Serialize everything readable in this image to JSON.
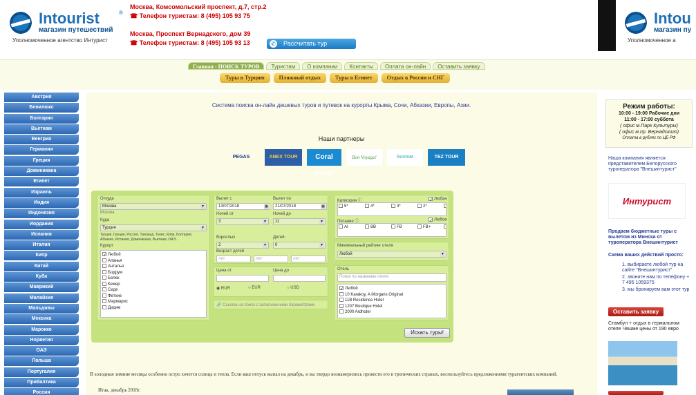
{
  "header": {
    "brand": "Intourist",
    "brand_mark": "®",
    "brand_sub": "магазин путешествий",
    "tagline": "Уполномоченное агентство Интурист",
    "address1": "Москва, Комсомольский проспект, д.7, стр.2",
    "phone1": "☎ Телефон туристам: 8 (495) 105 93 75",
    "address2": "Москва, Проспект Вернадского, дом 39",
    "phone2": "☎ Телефон туристам: 8 (495) 105 93 13",
    "calc_button": "Рассчитать тур",
    "calc_icon": "phone-icon",
    "brand_repeat": "Intou",
    "brand_sub_repeat": "магазин пу",
    "tagline_repeat": "Уполномоченное а"
  },
  "nav": {
    "tabs": [
      "Главная - ПОИСК ТУРОВ",
      "Туристам",
      "О компании",
      "Контакты",
      "Оплата он-лайн",
      "Оставить заявку"
    ],
    "subtabs": [
      "Туры в Турцию",
      "Пляжный отдых",
      "Туры в Египет",
      "Отдых в России и СНГ"
    ]
  },
  "sidebar": {
    "items": [
      "Австрия",
      "Бенилюкс",
      "Болгария",
      "Вьетнам",
      "Венгрия",
      "Германия",
      "Греция",
      "Доминикана",
      "Египет",
      "Израиль",
      "Индия",
      "Индонезия",
      "Иордания",
      "Испания",
      "Италия",
      "Кипр",
      "Китай",
      "Куба",
      "Маврикий",
      "Малайзия",
      "Мальдивы",
      "Мексика",
      "Марокко",
      "Норвегия",
      "ОАЭ",
      "Польша",
      "Португалия",
      "Прибалтика",
      "Россия"
    ]
  },
  "main": {
    "slogan": "Система поиска он-лайн дешевых туров и путевок на курорты Крыма, Сочи, Абхазии, Европы, Азии.",
    "partners_title": "Наши партнеры",
    "partners": [
      "PEGAS",
      "ANEX TOUR",
      "Coral travel",
      "Bon Voyage!",
      "Sunmar",
      "TEZ TOUR"
    ],
    "paragraph": "В холодные зимние месяцы особенно остро хочется солнца и тепла. Если ваш отпуск выпал на декабрь, и вы твердо вознамерились провести его в тропических странах, воспользуйтесь предложениями турагентских компаний.",
    "signature": "Итак, декабрь 2018г."
  },
  "form": {
    "from_label": "Откуда",
    "from_value": "Москва",
    "from_hint": "Москва",
    "to_label": "Куда",
    "to_value": "Турция",
    "to_hint": "Турция, Греция, Россия, Таиланд, Тунис, Кипр, Болгария, Абхазия, Испания, Доминикана, Вьетнам, ОАЭ...",
    "resorts_label": "Курорт",
    "resorts": [
      "Любой",
      "Аланья",
      "Анталья",
      "Бодрум",
      "Белек",
      "Кемер",
      "Сиде",
      "Фетхие",
      "Мармарис",
      "Дидим"
    ],
    "depart_from_label": "Вылет с",
    "depart_from": "13/07/2018",
    "depart_to_label": "Вылет по",
    "depart_to": "21/07/2018",
    "nights_from_label": "Ночей от",
    "nights_from": "3",
    "nights_to_label": "Ночей до",
    "nights_to": "11",
    "adults_label": "Взрослых",
    "adults": "2",
    "children_label": "Детей",
    "children": "0",
    "child_age_label": "Возраст детей",
    "child_ages": [
      "лет",
      "лет",
      "лет"
    ],
    "price_from_label": "Цена от",
    "price_to_label": "Цена до",
    "currencies": [
      "RUR",
      "EUR",
      "USD"
    ],
    "share_hint": "Ссылка на поиск с заполненными параметрами",
    "category_label": "Категория",
    "category_any": "Любая",
    "categories": [
      "5*",
      "4*",
      "3*",
      "2*",
      "1*",
      "HV"
    ],
    "meal_label": "Питание",
    "meal_any": "Любое",
    "meals": [
      "AI",
      "BB",
      "FB",
      "FB+",
      "HB",
      "HB+",
      "RO",
      "UAI"
    ],
    "rating_label": "Минимальный рейтинг отеля",
    "rating_value": "Любой",
    "hotel_label": "Отель",
    "hotel_placeholder": "Поиск по названию отеля",
    "hotels": [
      "Любой",
      "10 Karakoy, A Morgans Original",
      "11B Residence Hotel",
      "1207 Boutique Hotel",
      "2000 Ardhotel"
    ],
    "search_button": "Искать туры!"
  },
  "right": {
    "hours_title": "Режим работы:",
    "hours1": "10:00 - 19:00 Рабочие дни",
    "hours2": "11:00 - 17:00 суббота",
    "hours3": "( офис м.Парк Культуры)",
    "hours4": "( офис м.пр. Вернадского)",
    "hours5": "Оплата в рублях по ЦБ РФ",
    "promo1": "Наша компания является представителем Белорусского туроператора \"Внешинтурист\"",
    "intourist_logo": "Интурист",
    "promo2": "Продаем бюджетные туры с вылетом из Минска от туроператора Внешинтурист",
    "steps_title": "Схема ваших действий просто:",
    "steps": [
      "1. выбираете любой тур на сайте \"Внешинтурист\"",
      "2. звоните нам по телефону + 7 495 1059375",
      "3. мы бронируем вам этот тур"
    ],
    "leave_request": "Оставить заявку",
    "news": "Стамбул + отдых в термальном отеле Чешме цены от 190 евро"
  }
}
